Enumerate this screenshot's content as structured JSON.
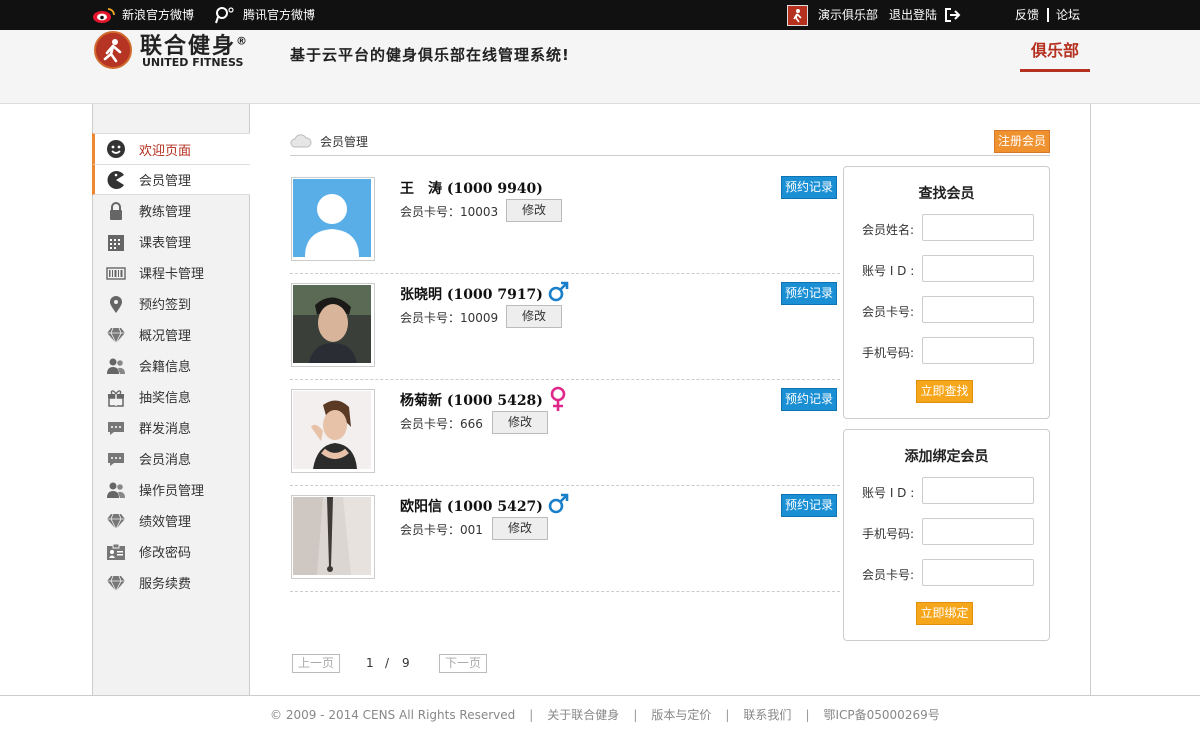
{
  "topbar": {
    "weibo_sina": "新浪官方微博",
    "weibo_tencent": "腾讯官方微博",
    "club_name": "演示俱乐部",
    "logout": "退出登陆",
    "feedback": "反馈",
    "forum": "论坛"
  },
  "header": {
    "logo_cn": "联合健身",
    "logo_reg": "®",
    "logo_en": "UNITED FITNESS",
    "slogan": "基于云平台的健身俱乐部在线管理系统!",
    "club_tab": "俱乐部"
  },
  "sidebar": {
    "items": [
      {
        "label": "欢迎页面",
        "icon": "smiley-icon"
      },
      {
        "label": "会员管理",
        "icon": "pacman-icon"
      },
      {
        "label": "教练管理",
        "icon": "lock-icon"
      },
      {
        "label": "课表管理",
        "icon": "calendar-icon"
      },
      {
        "label": "课程卡管理",
        "icon": "barcode-icon"
      },
      {
        "label": "预约签到",
        "icon": "location-pin-icon"
      },
      {
        "label": "概况管理",
        "icon": "diamond-icon"
      },
      {
        "label": "会籍信息",
        "icon": "users-icon"
      },
      {
        "label": "抽奖信息",
        "icon": "gift-icon"
      },
      {
        "label": "群发消息",
        "icon": "chat-icon"
      },
      {
        "label": "会员消息",
        "icon": "chat-icon"
      },
      {
        "label": "操作员管理",
        "icon": "users-icon"
      },
      {
        "label": "绩效管理",
        "icon": "diamond-icon"
      },
      {
        "label": "修改密码",
        "icon": "id-card-icon"
      },
      {
        "label": "服务续费",
        "icon": "diamond-icon"
      }
    ]
  },
  "main": {
    "section_title": "会员管理",
    "register_button": "注册会员",
    "card_label": "会员卡号：",
    "edit_label": "修改",
    "record_label": "预约记录",
    "members": [
      {
        "name": "王　涛 (1000 9940)",
        "card": "10003",
        "gender": ""
      },
      {
        "name": "张晓明 (1000 7917)",
        "card": "10009",
        "gender": "male"
      },
      {
        "name": "杨菊新 (1000 5428)",
        "card": "666",
        "gender": "female"
      },
      {
        "name": "欧阳信 (1000 5427)",
        "card": "001",
        "gender": "male"
      }
    ]
  },
  "search_panel": {
    "title": "查找会员",
    "name_label": "会员姓名:",
    "account_label": "账号 I D :",
    "card_label": "会员卡号:",
    "phone_label": "手机号码:",
    "button": "立即查找"
  },
  "bind_panel": {
    "title": "添加绑定会员",
    "account_label": "账号 I D :",
    "phone_label": "手机号码:",
    "card_label": "会员卡号:",
    "button": "立即绑定"
  },
  "pager": {
    "prev": "上一页",
    "current": "1",
    "slash": "/",
    "total": "9",
    "next": "下一页"
  },
  "footer": {
    "copyright": "© 2009 - 2014 CENS All Rights Reserved",
    "about": "关于联合健身",
    "pricing": "版本与定价",
    "contact": "联系我们",
    "icp": "鄂ICP备05000269号"
  },
  "colors": {
    "brand_red": "#b5301f",
    "orange": "#f0912f",
    "blue": "#1a8fd4",
    "male": "#1a7fc9",
    "female": "#e0288a"
  }
}
